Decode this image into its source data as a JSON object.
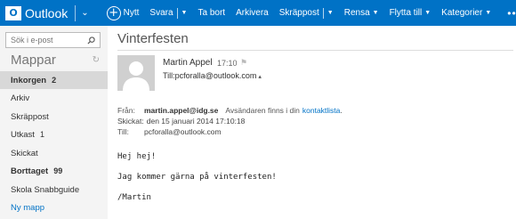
{
  "app": {
    "name": "Outlook"
  },
  "toolbar": {
    "new_label": "Nytt",
    "reply_label": "Svara",
    "delete_label": "Ta bort",
    "archive_label": "Arkivera",
    "junk_label": "Skräppost",
    "sweep_label": "Rensa",
    "move_label": "Flytta till",
    "categories_label": "Kategorier",
    "more_label": "•••"
  },
  "sidebar": {
    "search_placeholder": "Sök i e-post",
    "folders_title": "Mappar",
    "folders": [
      {
        "label": "Inkorgen",
        "count": "2",
        "selected": true,
        "bold": true
      },
      {
        "label": "Arkiv",
        "count": ""
      },
      {
        "label": "Skräppost",
        "count": ""
      },
      {
        "label": "Utkast",
        "count": "1"
      },
      {
        "label": "Skickat",
        "count": ""
      },
      {
        "label": "Borttaget",
        "count": "99",
        "bold": true
      },
      {
        "label": "Skola Snabbguide",
        "count": ""
      },
      {
        "label": "Ny mapp",
        "count": "",
        "link": true
      }
    ]
  },
  "message": {
    "subject": "Vinterfesten",
    "sender_name": "Martin Appel",
    "time": "17:10",
    "to_summary": "Till:pcforalla@outlook.com",
    "from_label": "Från:",
    "from_address": "martin.appel@idg.se",
    "from_note": "Avsändaren finns i din",
    "from_note_link": "kontaktlista",
    "from_note_end": ".",
    "sent_label": "Skickat:",
    "sent_value": "den 15 januari 2014 17:10:18",
    "to_label": "Till:",
    "to_value": "pcforalla@outlook.com",
    "body": [
      "Hej hej!",
      "Jag kommer gärna på vinterfesten!",
      "/Martin"
    ]
  }
}
